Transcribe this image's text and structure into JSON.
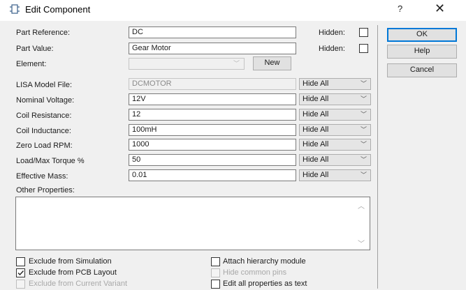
{
  "window": {
    "title": "Edit Component",
    "help_glyph": "?",
    "close_glyph": "✕"
  },
  "fields": [
    {
      "label": "Part Reference:",
      "value": "DC"
    },
    {
      "label": "Part Value:",
      "value": "Gear Motor"
    },
    {
      "label": "Element:",
      "value": ""
    }
  ],
  "hidden_label": "Hidden:",
  "new_button": "New",
  "props": [
    {
      "label": "LISA Model File:",
      "value": "DCMOTOR",
      "visibility": "Hide All"
    },
    {
      "label": "Nominal Voltage:",
      "value": "12V",
      "visibility": "Hide All"
    },
    {
      "label": "Coil Resistance:",
      "value": "12",
      "visibility": "Hide All"
    },
    {
      "label": "Coil Inductance:",
      "value": "100mH",
      "visibility": "Hide All"
    },
    {
      "label": "Zero Load RPM:",
      "value": "1000",
      "visibility": "Hide All"
    },
    {
      "label": "Load/Max Torque %",
      "value": "50",
      "visibility": "Hide All"
    },
    {
      "label": "Effective Mass:",
      "value": "0.01",
      "visibility": "Hide All"
    }
  ],
  "other_properties_label": "Other Properties:",
  "buttons": {
    "ok": "OK",
    "help": "Help",
    "cancel": "Cancel"
  },
  "options": [
    {
      "label": "Exclude from Simulation",
      "checked": false,
      "enabled": true
    },
    {
      "label": "Exclude from PCB Layout",
      "checked": true,
      "enabled": true
    },
    {
      "label": "Exclude from Current Variant",
      "checked": false,
      "enabled": false
    },
    {
      "label": "Attach hierarchy module",
      "checked": false,
      "enabled": true
    },
    {
      "label": "Hide common pins",
      "checked": false,
      "enabled": false
    },
    {
      "label": "Edit all properties as text",
      "checked": false,
      "enabled": true
    }
  ]
}
